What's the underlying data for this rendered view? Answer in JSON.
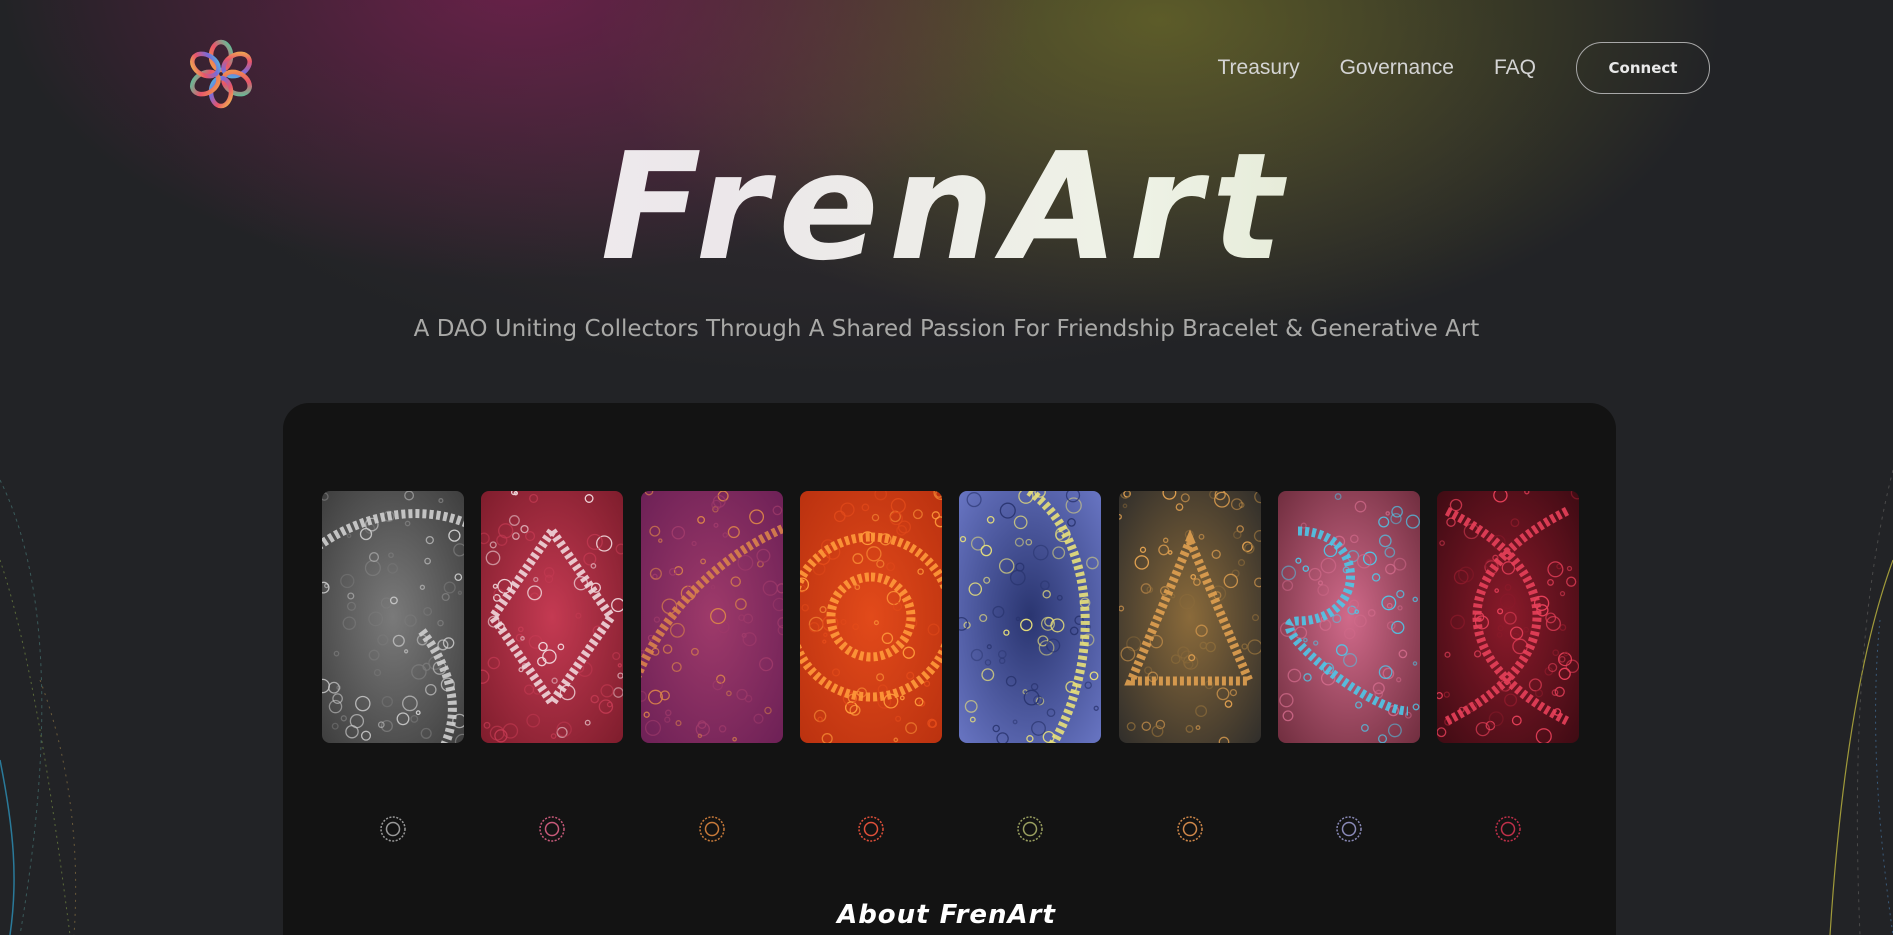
{
  "header": {
    "logo": "frenart-flower-logo",
    "nav": [
      {
        "label": "Treasury"
      },
      {
        "label": "Governance"
      },
      {
        "label": "FAQ"
      }
    ],
    "connect_label": "Connect"
  },
  "hero": {
    "title": "FrenArt",
    "subtitle": "A DAO Uniting Collectors Through A Shared Passion For Friendship Bracelet & Generative Art"
  },
  "gallery": {
    "artworks": [
      {
        "name": "monochrome chains",
        "palette": [
          "#3a3a3a",
          "#cfcfcf",
          "#7a7a7a"
        ]
      },
      {
        "name": "red diamond",
        "palette": [
          "#7a1b2a",
          "#f0d6da",
          "#c43a52"
        ]
      },
      {
        "name": "purple strands",
        "palette": [
          "#6a1f55",
          "#d9824a",
          "#9e3a6a"
        ]
      },
      {
        "name": "orange rings",
        "palette": [
          "#b8300f",
          "#ff9a3a",
          "#e24a1a"
        ]
      },
      {
        "name": "blue yellow arc",
        "palette": [
          "#6c79c8",
          "#e8e07a",
          "#2a3570"
        ]
      },
      {
        "name": "golden triangle",
        "palette": [
          "#2a2a2a",
          "#e0a050",
          "#8a6a3a"
        ]
      },
      {
        "name": "cyan knot",
        "palette": [
          "#6a2a3a",
          "#4fc7e8",
          "#d06a8a"
        ]
      },
      {
        "name": "crimson infinity",
        "palette": [
          "#3a0a12",
          "#e8405a",
          "#8a1a2a"
        ]
      }
    ],
    "dot_colors": [
      "#9a9a9a",
      "#c85a7a",
      "#c87a3a",
      "#e0503a",
      "#9aa060",
      "#d0884a",
      "#8a8ab8",
      "#c0304a"
    ]
  },
  "about": {
    "title": "About FrenArt"
  }
}
